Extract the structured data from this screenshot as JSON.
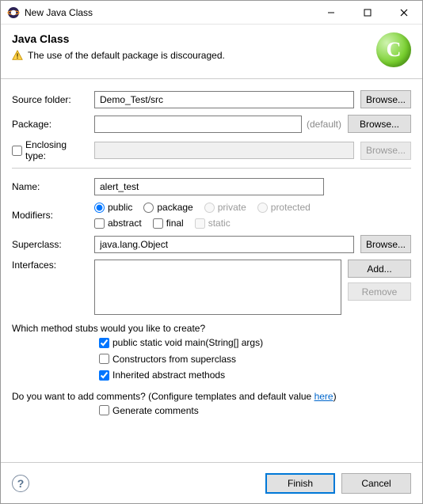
{
  "window": {
    "title": "New Java Class"
  },
  "header": {
    "title": "Java Class",
    "warning": "The use of the default package is discouraged."
  },
  "labels": {
    "source_folder": "Source folder:",
    "package": "Package:",
    "enclosing_type": "Enclosing type:",
    "name": "Name:",
    "modifiers": "Modifiers:",
    "superclass": "Superclass:",
    "interfaces": "Interfaces:",
    "default_note": "(default)"
  },
  "values": {
    "source_folder": "Demo_Test/src",
    "package": "",
    "enclosing_type": "",
    "name": "alert_test",
    "superclass": "java.lang.Object"
  },
  "buttons": {
    "browse": "Browse...",
    "add": "Add...",
    "remove": "Remove",
    "finish": "Finish",
    "cancel": "Cancel"
  },
  "modifiers": {
    "access": {
      "public": "public",
      "package": "package",
      "private": "private",
      "protected": "protected"
    },
    "abstract": "abstract",
    "final": "final",
    "static": "static"
  },
  "stubs": {
    "question": "Which method stubs would you like to create?",
    "main": "public static void main(String[] args)",
    "constructors": "Constructors from superclass",
    "inherited": "Inherited abstract methods"
  },
  "comments": {
    "question_prefix": "Do you want to add comments? (Configure templates and default value ",
    "link": "here",
    "question_suffix": ")",
    "generate": "Generate comments"
  }
}
